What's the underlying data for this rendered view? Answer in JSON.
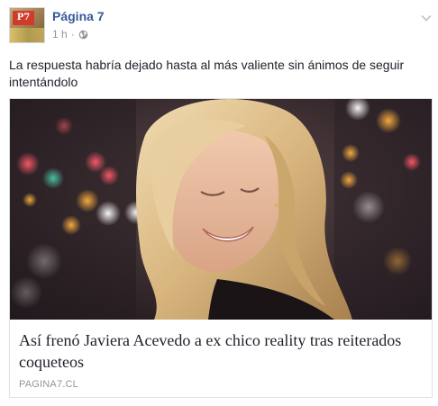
{
  "post": {
    "page_name": "Página 7",
    "avatar_text": "P7",
    "time": "1 h",
    "separator": "·",
    "privacy_icon": "globe-icon",
    "menu_icon": "chevron-down-icon",
    "text": "La respuesta habría dejado hasta al más valiente sin ánimos de seguir intentándolo"
  },
  "link": {
    "title": "Así frenó Javiera Acevedo a ex chico reality tras reiterados coqueteos",
    "domain": "PAGINA7.CL",
    "image_description_icon": "photo-woman-smiling"
  },
  "colors": {
    "link_blue": "#365899",
    "meta_gray": "#90949c",
    "text_dark": "#1d2129",
    "border": "#dddfe2"
  }
}
